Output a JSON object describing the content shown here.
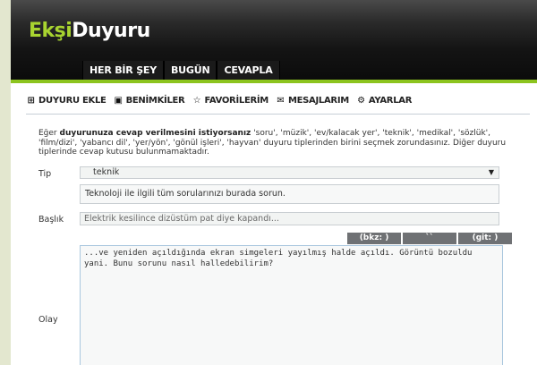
{
  "logo": {
    "part1": "Ekşi",
    "part2": "Duyuru"
  },
  "topnav": [
    "HER BİR ŞEY",
    "BUGÜN",
    "CEVAPLA"
  ],
  "subnav": [
    {
      "label": "DUYURU EKLE",
      "icon": "add-post-icon"
    },
    {
      "label": "BENİMKİLER",
      "icon": "my-posts-icon"
    },
    {
      "label": "FAVORİLERİM",
      "icon": "star-icon"
    },
    {
      "label": "MESAJLARIM",
      "icon": "envelope-icon"
    },
    {
      "label": "AYARLAR",
      "icon": "gear-icon"
    }
  ],
  "intro": {
    "prefix": "Eğer ",
    "bold": "duyurunuza cevap verilmesini istiyorsanız",
    "rest": " 'soru', 'müzik', 'ev/kalacak yer', 'teknik', 'medikal', 'sözlük', 'film/dizi', 'yabancı dil', 'yer/yön', 'gönül işleri', 'hayvan' duyuru tiplerinden birini seçmek zorundasınız. Diğer duyuru tiplerinde cevap kutusu bulunmamaktadır."
  },
  "form": {
    "type_label": "Tip",
    "type_value": "teknik",
    "type_description": "Teknoloji ile ilgili tüm sorularınızı burada sorun.",
    "title_label": "Başlık",
    "title_value": "Elektrik kesilince dizüstüm pat diye kapandı...",
    "body_label": "Olay",
    "body_value": "...ve yeniden açıldığında ekran simgeleri yayılmış halde açıldı. Görüntü bozuldu yani. Bunu sorunu nasıl halledebilirim?"
  },
  "editor_buttons": {
    "bkz": "(bkz: )",
    "tick": "``",
    "git": "(git: )"
  }
}
